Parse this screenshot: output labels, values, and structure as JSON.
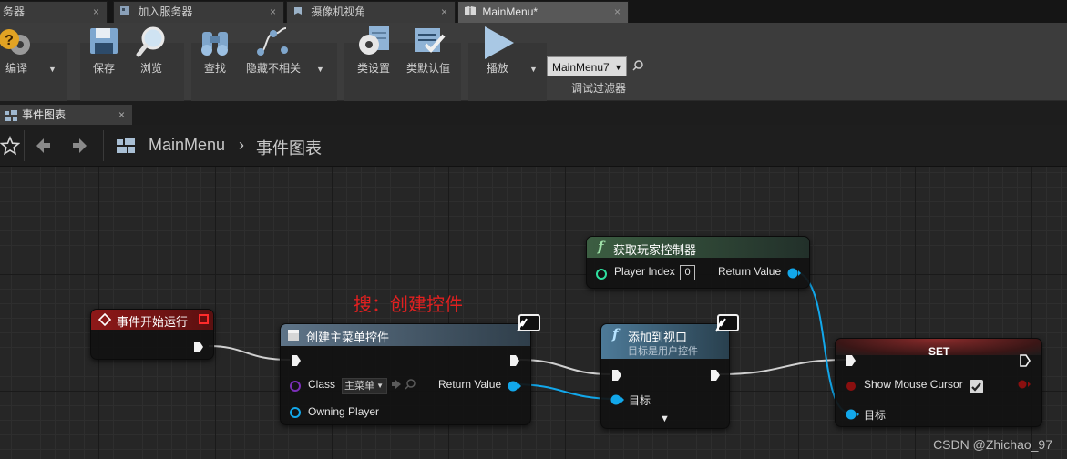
{
  "tabs": [
    {
      "label": "务器"
    },
    {
      "label": "加入服务器"
    },
    {
      "label": "摄像机视角"
    },
    {
      "label": "MainMenu*"
    }
  ],
  "tab_close": "×",
  "toolbar": {
    "compile": "编译",
    "save": "保存",
    "browse": "浏览",
    "find": "查找",
    "hide_unrelated": "隐藏不相关",
    "class_settings": "类设置",
    "class_defaults": "类默认值",
    "play": "播放",
    "debug_object": "MainMenu7",
    "debug_filter": "调试过滤器",
    "dropdown_arrow": "▼"
  },
  "graph_tab": {
    "label": "事件图表",
    "close": "×"
  },
  "breadcrumb": {
    "root": "MainMenu",
    "sep": "›",
    "current": "事件图表"
  },
  "annotation": "搜：创建控件",
  "nodes": {
    "begin_play": {
      "title": "事件开始运行"
    },
    "create_widget": {
      "title": "创建主菜单控件",
      "class_label": "Class",
      "class_value": "主菜单",
      "return_label": "Return Value",
      "owning_label": "Owning Player"
    },
    "get_player_controller": {
      "title": "获取玩家控制器",
      "player_index_label": "Player Index",
      "player_index_value": "0",
      "return_label": "Return Value"
    },
    "add_to_viewport": {
      "title": "添加到视口",
      "subtitle": "目标是用户控件",
      "target_label": "目标",
      "expand": "▼"
    },
    "set_node": {
      "title": "SET",
      "show_cursor_label": "Show Mouse Cursor",
      "show_cursor_checked": true,
      "target_label": "目标"
    }
  },
  "function_glyph": "f",
  "watermark": "CSDN @Zhichao_97",
  "colors": {
    "event_header": "#7a1414",
    "function_header": "#2e4a33",
    "target_function_header": "#3d5a6e",
    "set_header": "#5a1f1f",
    "object_pin": "#12a7ea",
    "class_pin": "#7b2fb8",
    "bool_pin": "#8a0f0f",
    "annotation": "#e02020"
  }
}
